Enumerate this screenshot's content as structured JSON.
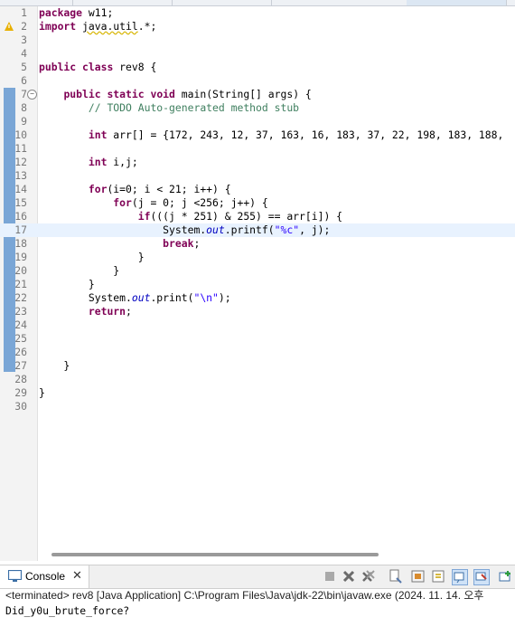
{
  "editor": {
    "lines": [
      {
        "n": "1",
        "t": [
          {
            "c": "kw",
            "v": "package"
          },
          {
            "c": "",
            "v": " w11;"
          }
        ]
      },
      {
        "n": "2",
        "warn": true,
        "t": [
          {
            "c": "kw",
            "v": "import"
          },
          {
            "c": "",
            "v": " "
          },
          {
            "c": "ul",
            "v": "java.util"
          },
          {
            "c": "",
            "v": ".*;"
          }
        ]
      },
      {
        "n": "3",
        "t": []
      },
      {
        "n": "4",
        "t": []
      },
      {
        "n": "5",
        "t": [
          {
            "c": "kw",
            "v": "public"
          },
          {
            "c": "",
            "v": " "
          },
          {
            "c": "kw",
            "v": "class"
          },
          {
            "c": "",
            "v": " rev8 {"
          }
        ]
      },
      {
        "n": "6",
        "t": []
      },
      {
        "n": "7",
        "fold": "−",
        "t": [
          {
            "c": "",
            "v": "    "
          },
          {
            "c": "kw",
            "v": "public"
          },
          {
            "c": "",
            "v": " "
          },
          {
            "c": "kw",
            "v": "static"
          },
          {
            "c": "",
            "v": " "
          },
          {
            "c": "kw",
            "v": "void"
          },
          {
            "c": "",
            "v": " main(String[] args) {"
          }
        ]
      },
      {
        "n": "8",
        "t": [
          {
            "c": "",
            "v": "        "
          },
          {
            "c": "cm",
            "v": "// TODO Auto-generated method stub"
          }
        ]
      },
      {
        "n": "9",
        "t": []
      },
      {
        "n": "10",
        "t": [
          {
            "c": "",
            "v": "        "
          },
          {
            "c": "kw",
            "v": "int"
          },
          {
            "c": "",
            "v": " arr[] = {172, 243, 12, 37, 163, 16, 183, 37, 22, 198, 183, 188,"
          }
        ]
      },
      {
        "n": "11",
        "t": []
      },
      {
        "n": "12",
        "t": [
          {
            "c": "",
            "v": "        "
          },
          {
            "c": "kw",
            "v": "int"
          },
          {
            "c": "",
            "v": " i,j;"
          }
        ]
      },
      {
        "n": "13",
        "t": []
      },
      {
        "n": "14",
        "t": [
          {
            "c": "",
            "v": "        "
          },
          {
            "c": "kw",
            "v": "for"
          },
          {
            "c": "",
            "v": "(i=0; i < 21; i++) {"
          }
        ]
      },
      {
        "n": "15",
        "t": [
          {
            "c": "",
            "v": "            "
          },
          {
            "c": "kw",
            "v": "for"
          },
          {
            "c": "",
            "v": "(j = 0; j <256; j++) {"
          }
        ]
      },
      {
        "n": "16",
        "t": [
          {
            "c": "",
            "v": "                "
          },
          {
            "c": "kw",
            "v": "if"
          },
          {
            "c": "",
            "v": "(((j * 251) & 255) == arr[i]) {"
          }
        ]
      },
      {
        "n": "17",
        "cur": true,
        "t": [
          {
            "c": "",
            "v": "                    System."
          },
          {
            "c": "fld",
            "v": "out"
          },
          {
            "c": "",
            "v": ".printf("
          },
          {
            "c": "str",
            "v": "\"%c\""
          },
          {
            "c": "",
            "v": ", j);"
          }
        ]
      },
      {
        "n": "18",
        "t": [
          {
            "c": "",
            "v": "                    "
          },
          {
            "c": "kw",
            "v": "break"
          },
          {
            "c": "",
            "v": ";"
          }
        ]
      },
      {
        "n": "19",
        "t": [
          {
            "c": "",
            "v": "                }"
          }
        ]
      },
      {
        "n": "20",
        "t": [
          {
            "c": "",
            "v": "            }"
          }
        ]
      },
      {
        "n": "21",
        "t": [
          {
            "c": "",
            "v": "        }"
          }
        ]
      },
      {
        "n": "22",
        "t": [
          {
            "c": "",
            "v": "        System."
          },
          {
            "c": "fld",
            "v": "out"
          },
          {
            "c": "",
            "v": ".print("
          },
          {
            "c": "str",
            "v": "\"\\n\""
          },
          {
            "c": "",
            "v": ");"
          }
        ]
      },
      {
        "n": "23",
        "t": [
          {
            "c": "",
            "v": "        "
          },
          {
            "c": "kw",
            "v": "return"
          },
          {
            "c": "",
            "v": ";"
          }
        ]
      },
      {
        "n": "24",
        "t": []
      },
      {
        "n": "25",
        "t": []
      },
      {
        "n": "26",
        "t": []
      },
      {
        "n": "27",
        "t": [
          {
            "c": "",
            "v": "    }"
          }
        ]
      },
      {
        "n": "28",
        "t": []
      },
      {
        "n": "29",
        "t": [
          {
            "c": "",
            "v": "}"
          }
        ]
      },
      {
        "n": "30",
        "t": []
      }
    ]
  },
  "console": {
    "tab_label": "Console",
    "close_glyph": "✕",
    "status": "<terminated> rev8 [Java Application] C:\\Program Files\\Java\\jdk-22\\bin\\javaw.exe  (2024. 11. 14. 오후",
    "output": "Did_y0u_brute_force?"
  },
  "toolbar_icons": [
    "terminate-icon",
    "remove-launch-icon",
    "remove-all-icon",
    "clear-console-icon",
    "scroll-lock-icon",
    "word-wrap-icon",
    "pin-console-icon",
    "display-console-icon",
    "open-console-icon",
    "new-console-icon"
  ]
}
